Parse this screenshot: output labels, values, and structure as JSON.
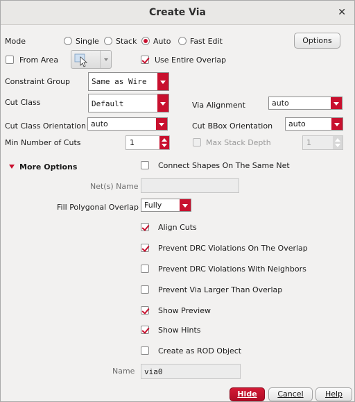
{
  "window": {
    "title": "Create Via",
    "close": "✕"
  },
  "mode": {
    "label": "Mode",
    "options": [
      "Single",
      "Stack",
      "Auto",
      "Fast Edit"
    ],
    "selected": "Auto",
    "options_button": "Options"
  },
  "from_area": {
    "label": "From Area",
    "checked": false
  },
  "use_entire_overlap": {
    "label": "Use Entire Overlap",
    "checked": true
  },
  "constraint_group": {
    "label": "Constraint Group",
    "value": "Same as Wire"
  },
  "cut_class": {
    "label": "Cut Class",
    "value": "Default"
  },
  "via_alignment": {
    "label": "Via Alignment",
    "value": "auto"
  },
  "cut_class_orientation": {
    "label": "Cut Class Orientation",
    "value": "auto"
  },
  "cut_bbox_orientation": {
    "label": "Cut BBox Orientation",
    "value": "auto"
  },
  "min_cuts": {
    "label": "Min Number of Cuts",
    "value": "1"
  },
  "max_stack_depth": {
    "label": "Max Stack Depth",
    "value": "1",
    "checked": false
  },
  "more_options": {
    "label": "More Options"
  },
  "connect_shapes": {
    "label": "Connect Shapes On The Same Net",
    "checked": false
  },
  "nets_name": {
    "label": "Net(s) Name",
    "value": ""
  },
  "fill_polygonal": {
    "label": "Fill Polygonal Overlap",
    "value": "Fully"
  },
  "options": [
    {
      "label": "Align Cuts",
      "checked": true
    },
    {
      "label": "Prevent DRC Violations On The Overlap",
      "checked": true
    },
    {
      "label": "Prevent DRC Violations With Neighbors",
      "checked": false
    },
    {
      "label": "Prevent Via Larger Than Overlap",
      "checked": false
    },
    {
      "label": "Show Preview",
      "checked": true
    },
    {
      "label": "Show Hints",
      "checked": true
    },
    {
      "label": "Create as ROD Object",
      "checked": false
    }
  ],
  "name": {
    "label": "Name",
    "value": "via0"
  },
  "buttons": {
    "hide": "Hide",
    "cancel": "Cancel",
    "help": "Help"
  },
  "colors": {
    "accent": "#c8102e",
    "bg": "#f2f1f0"
  }
}
